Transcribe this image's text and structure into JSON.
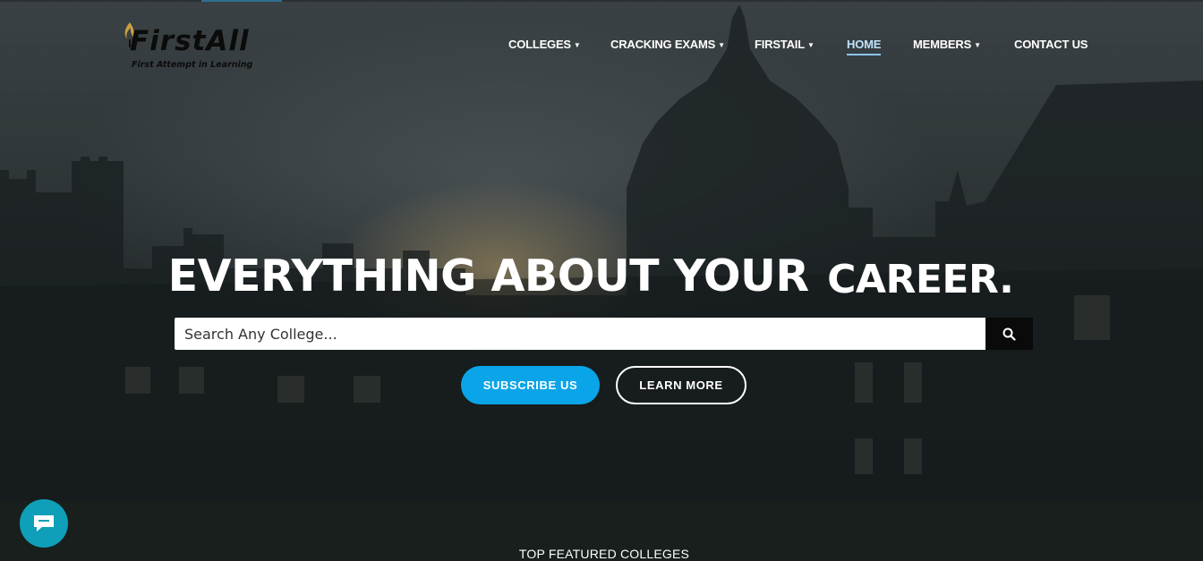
{
  "logo": {
    "brand": "FirstAll",
    "tagline": "First Attempt in Learning"
  },
  "nav": {
    "items": [
      {
        "label": "COLLEGES",
        "dropdown": true
      },
      {
        "label": "CRACKING EXAMS",
        "dropdown": true
      },
      {
        "label": "FIRSTAIL",
        "dropdown": true
      },
      {
        "label": "HOME",
        "dropdown": false,
        "active": true
      },
      {
        "label": "MEMBERS",
        "dropdown": true
      },
      {
        "label": "CONTACT US",
        "dropdown": false
      }
    ],
    "chevron_icon": "chevron-down-icon"
  },
  "hero": {
    "headline_part1": "EVERYTHING ABOUT YOUR",
    "headline_part2": "CAREER."
  },
  "search": {
    "placeholder": "Search Any College...",
    "value": "",
    "button_icon": "search-icon"
  },
  "buttons": {
    "subscribe": "SUBSCRIBE US",
    "learn_more": "LEARN MORE"
  },
  "chat": {
    "icon": "chat-bubble-icon"
  },
  "sections": {
    "featured_title": "TOP FEATURED COLLEGES"
  },
  "colors": {
    "accent": "#0aa4e8",
    "active_nav": "#bfe3ff",
    "chat_bubble": "#0f9fb8",
    "search_button": "#0a0a0a"
  }
}
